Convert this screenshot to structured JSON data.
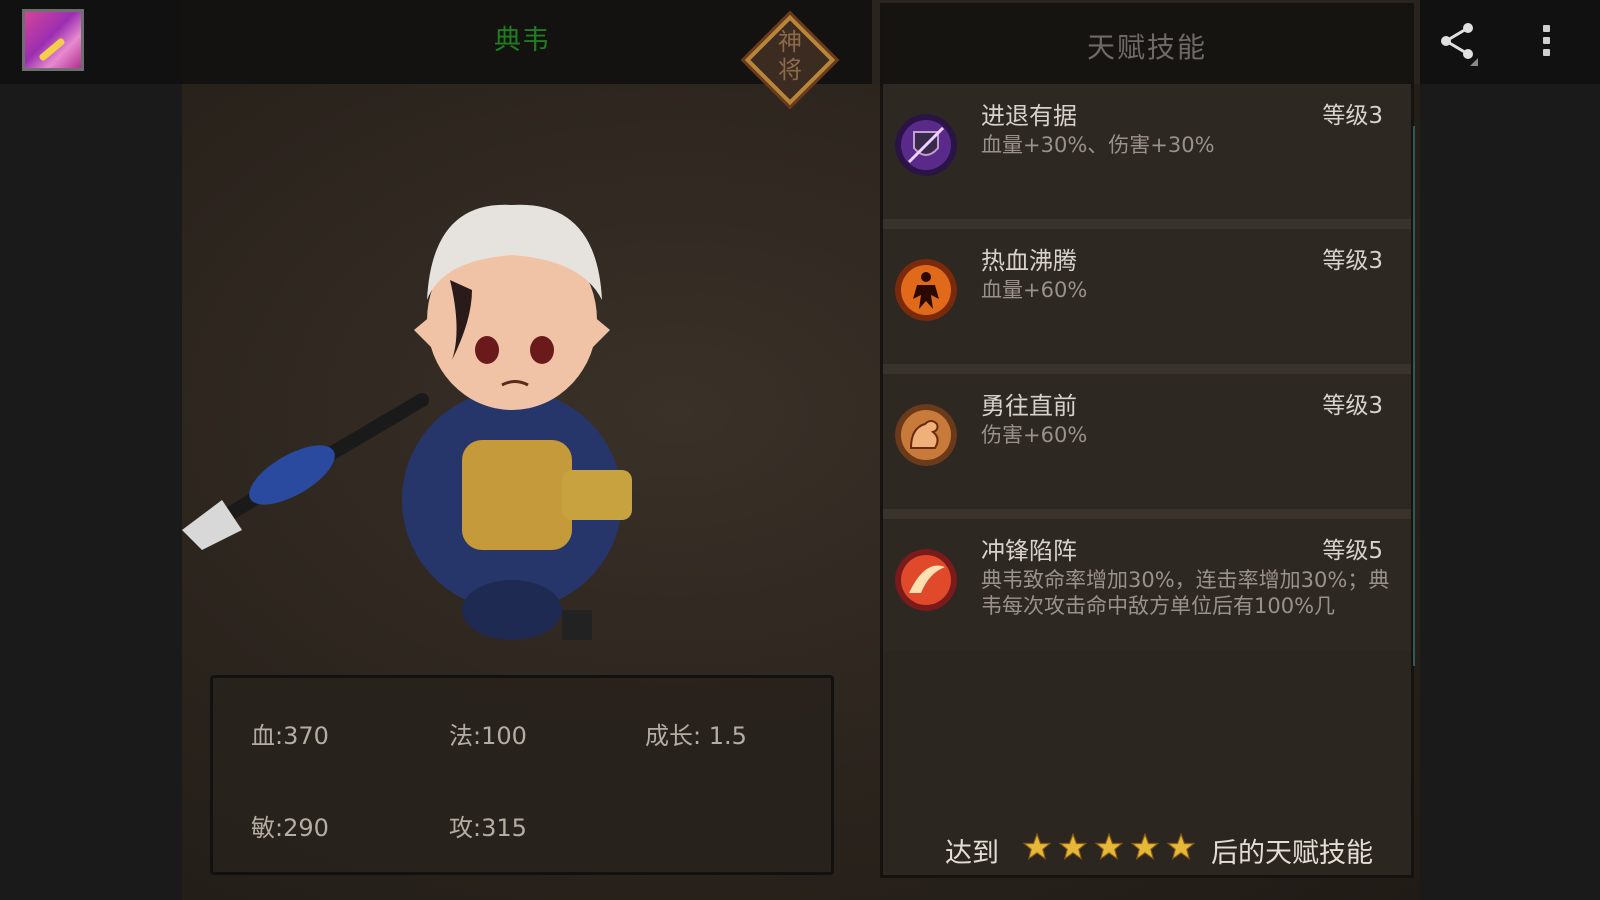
{
  "hero": {
    "name": "典韦",
    "rank_badge": "神将",
    "name_color": "#1e7d1e"
  },
  "stats": {
    "hp": "血:370",
    "mp": "法:100",
    "growth": "成长: 1.5",
    "agi": "敏:290",
    "atk": "攻:315"
  },
  "talent_panel": {
    "title": "天赋技能",
    "skills": [
      {
        "name": "进退有据",
        "level": "等级3",
        "desc": "血量+30%、伤害+30%",
        "icon": "shield-slash-icon"
      },
      {
        "name": "热血沸腾",
        "level": "等级3",
        "desc": "血量+60%",
        "icon": "warrior-flame-icon"
      },
      {
        "name": "勇往直前",
        "level": "等级3",
        "desc": "伤害+60%",
        "icon": "flexed-arm-icon"
      },
      {
        "name": "冲锋陷阵",
        "level": "等级5",
        "desc": "典韦致命率增加30%，连击率增加30%；典韦每次攻击命中敌方单位后有100%几",
        "icon": "fire-slash-icon"
      }
    ],
    "footer_prefix": "达到",
    "footer_stars": 5,
    "footer_suffix": "后的天赋技能"
  },
  "toolbar": {
    "app_icon": "gallery-app-icon",
    "share_icon": "share-icon",
    "more_icon": "more-vert-icon"
  }
}
